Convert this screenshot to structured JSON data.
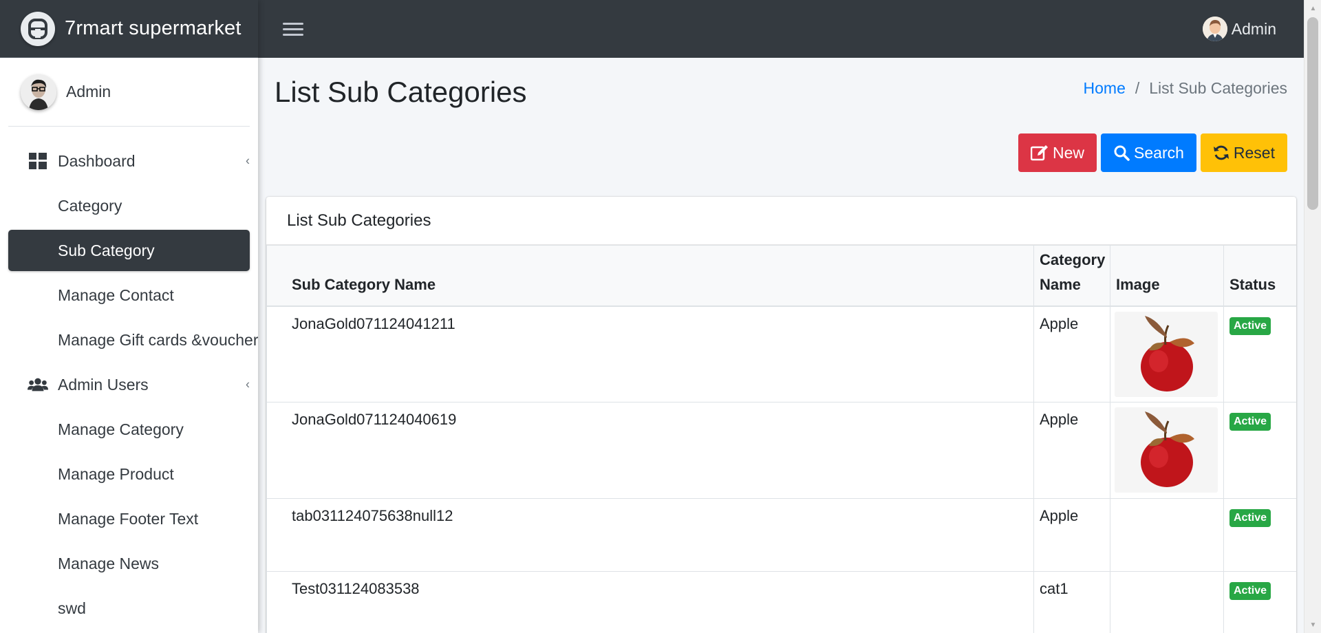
{
  "app": {
    "brand": "7rmart supermarket"
  },
  "sidebar": {
    "user": "Admin",
    "items": [
      {
        "label": "Dashboard"
      },
      {
        "label": "Category"
      },
      {
        "label": "Sub Category"
      },
      {
        "label": "Manage Contact"
      },
      {
        "label": "Manage Gift cards &voucher"
      },
      {
        "label": "Admin Users"
      },
      {
        "label": "Manage Category"
      },
      {
        "label": "Manage Product"
      },
      {
        "label": "Manage Footer Text"
      },
      {
        "label": "Manage News"
      },
      {
        "label": "swd"
      }
    ]
  },
  "topbar": {
    "user": "Admin"
  },
  "page": {
    "title": "List Sub Categories",
    "breadcrumb": {
      "home": "Home",
      "separator": "/",
      "current": "List Sub Categories"
    }
  },
  "actions": {
    "new": "New",
    "search": "Search",
    "reset": "Reset"
  },
  "card": {
    "title": "List Sub Categories"
  },
  "table": {
    "columns": [
      "Sub Category Name",
      "Category Name",
      "Image",
      "Status"
    ],
    "rows": [
      {
        "name": "JonaGold071124041211",
        "category": "Apple",
        "has_image": true,
        "status": "Active"
      },
      {
        "name": "JonaGold071124040619",
        "category": "Apple",
        "has_image": true,
        "status": "Active"
      },
      {
        "name": "tab031124075638null12",
        "category": "Apple",
        "has_image": false,
        "status": "Active"
      },
      {
        "name": "Test031124083538",
        "category": "cat1",
        "has_image": false,
        "status": "Active"
      }
    ]
  },
  "colors": {
    "topbar": "#343a40",
    "active_nav": "#343a40",
    "new_button": "#dc3545",
    "search_button": "#007bff",
    "reset_button": "#ffc107",
    "status_badge": "#28a745",
    "link": "#007bff"
  }
}
